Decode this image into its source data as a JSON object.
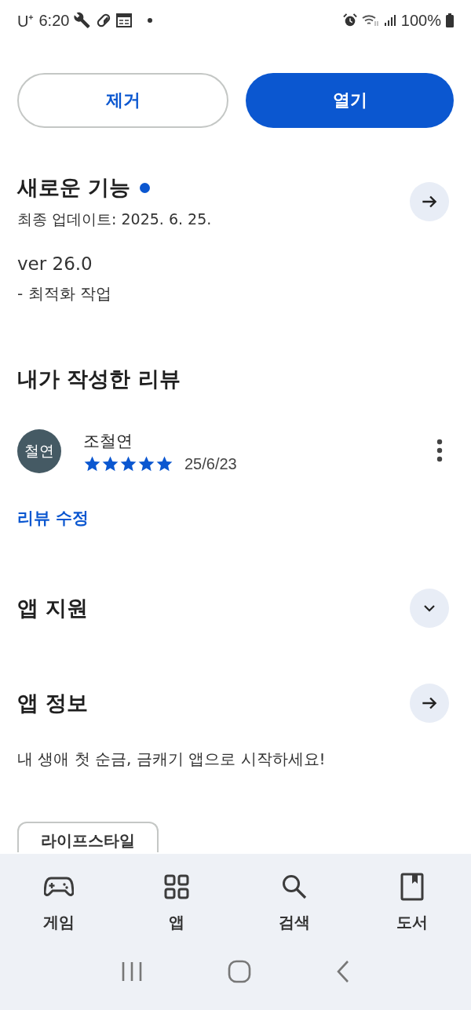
{
  "status_bar": {
    "carrier": "U⁺",
    "time": "6:20",
    "battery": "100%"
  },
  "actions": [
    {
      "label": "제거",
      "kind": "outline"
    },
    {
      "label": "열기",
      "kind": "filled"
    }
  ],
  "whats_new": {
    "title": "새로운 기능",
    "new_dot": true,
    "updated": "최종 업데이트: 2025. 6. 25.",
    "version": "ver 26.0",
    "notes": "- 최적화 작업"
  },
  "my_review": {
    "title": "내가 작성한 리뷰",
    "avatar": "철연",
    "author": "조철연",
    "stars": 5,
    "date": "25/6/23",
    "edit_link": "리뷰 수정"
  },
  "app_support": {
    "title": "앱 지원",
    "expanded": false
  },
  "app_info": {
    "title": "앱 정보",
    "description": "내 생애 첫 순금, 금캐기 앱으로 시작하세요!",
    "tags": [
      "라이프스타일"
    ]
  },
  "bottom_nav": [
    {
      "label": "게임",
      "selected": false
    },
    {
      "label": "앱",
      "selected": false
    },
    {
      "label": "검색",
      "selected": false
    },
    {
      "label": "도서",
      "selected": false
    }
  ]
}
